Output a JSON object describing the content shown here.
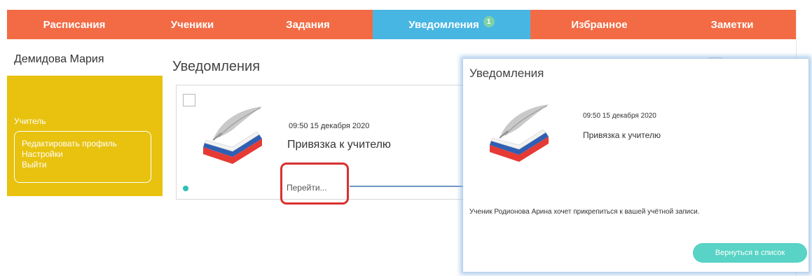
{
  "nav": {
    "items": [
      {
        "label": "Расписания"
      },
      {
        "label": "Ученики"
      },
      {
        "label": "Задания"
      },
      {
        "label": "Уведомления",
        "badge": "1"
      },
      {
        "label": "Избранное"
      },
      {
        "label": "Заметки"
      }
    ],
    "active_index": 3
  },
  "sidebar": {
    "user_name": "Демидова Мария",
    "role": "Учитель",
    "links": {
      "edit_profile": "Редактировать профиль",
      "settings": "Настройки",
      "logout": "Выйти"
    }
  },
  "notifications": {
    "title": "Уведомления",
    "item": {
      "datetime": "09:50 15 декабря 2020",
      "subject": "Привязка к учителю",
      "link": "Перейти...",
      "unread": true
    }
  },
  "detail": {
    "title": "Уведомления",
    "datetime": "09:50 15 декабря 2020",
    "subject": "Привязка к учителю",
    "message": "Ученик Родионова Арина хочет прикрепиться к вашей учётной записи.",
    "back_button": "Вернуться в список"
  },
  "icons": {
    "logo": "book-quill-logo-icon",
    "arrow": "arrow-right-icon"
  },
  "colors": {
    "nav_bg": "#f26b45",
    "nav_active": "#48b6e2",
    "sidebar_yellow": "#e8c20e",
    "accent_teal": "#58d3c5",
    "highlight_red": "#d93030",
    "arrow_blue": "#3f72b4"
  }
}
